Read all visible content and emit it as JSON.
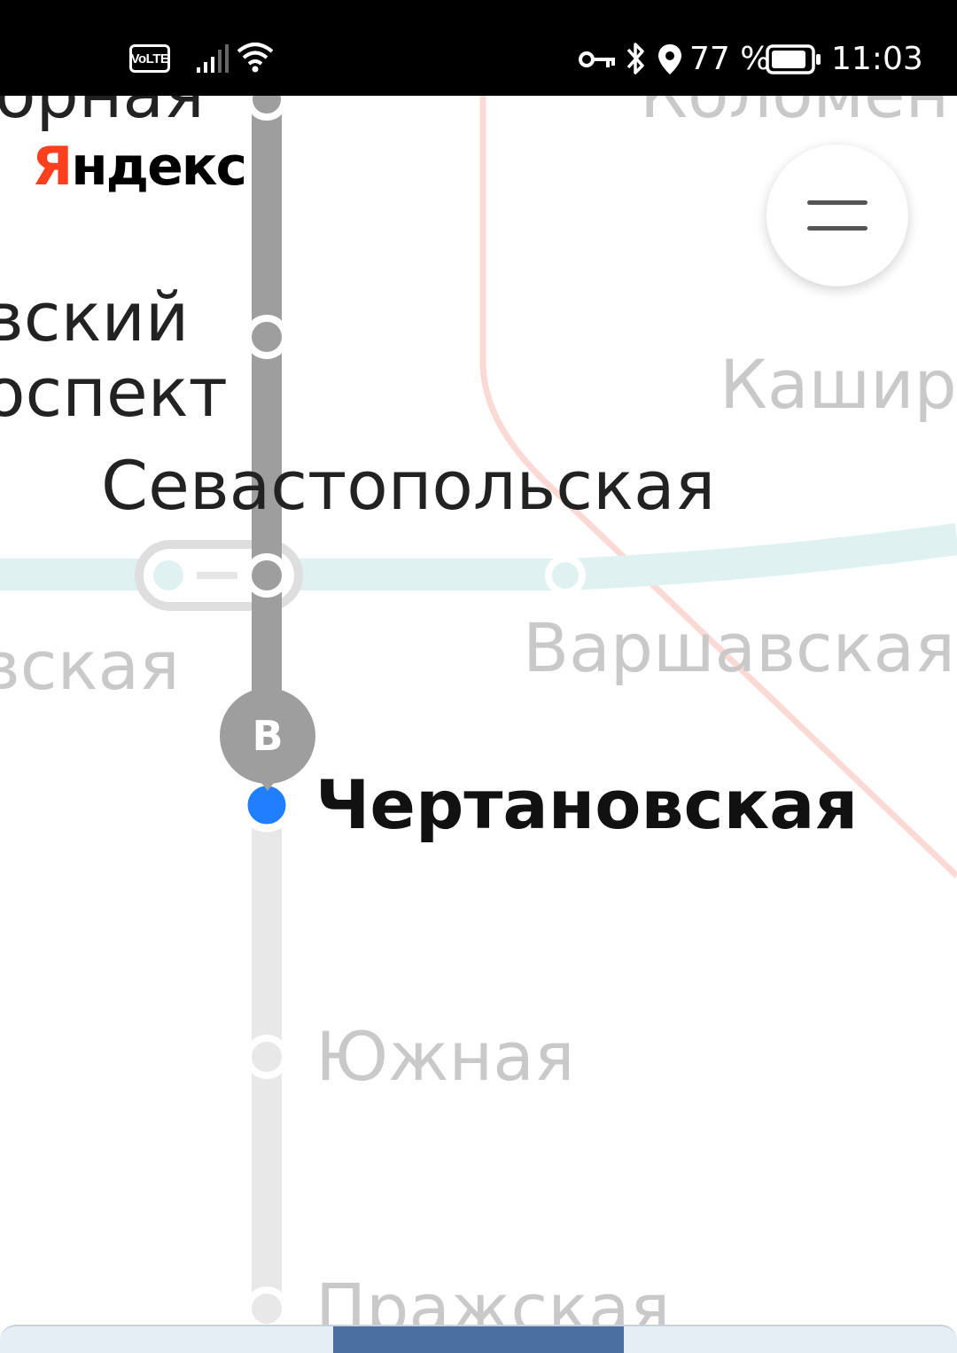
{
  "status_bar": {
    "volte": "VoLTE",
    "battery_percent": "77 %",
    "time": "11:03"
  },
  "brand": {
    "logo_first_letter": "Я",
    "logo_rest": "ндекс",
    "logo_color": "#fc3f1d"
  },
  "map": {
    "stations": {
      "top_left_partial": "орная",
      "top_right_partial": "Коломен",
      "prospekt_line1": "вский",
      "prospekt_line2": "оспект",
      "kashir_partial": "Кашир",
      "sevastopolskaya": "Севастопольская",
      "left_partial": "вская",
      "varshavskaya": "Варшавская",
      "chertanovskaya": "Чертановская",
      "yuzhnaya": "Южная",
      "prazhskaya": "Пражская"
    },
    "route_pin_label": "B",
    "colors": {
      "grey_line": "#9e9e9e",
      "light_line": "#e8e8e8",
      "teal_line": "#dff2f1",
      "red_line": "#fbd7d2",
      "current_station": "#1f7fff"
    }
  },
  "icons": {
    "menu": "hamburger-menu-icon",
    "key": "vpn-key-icon",
    "bluetooth": "bluetooth-icon",
    "location": "location-pin-icon",
    "battery": "battery-icon",
    "signal": "signal-icon",
    "wifi": "wifi-icon"
  }
}
